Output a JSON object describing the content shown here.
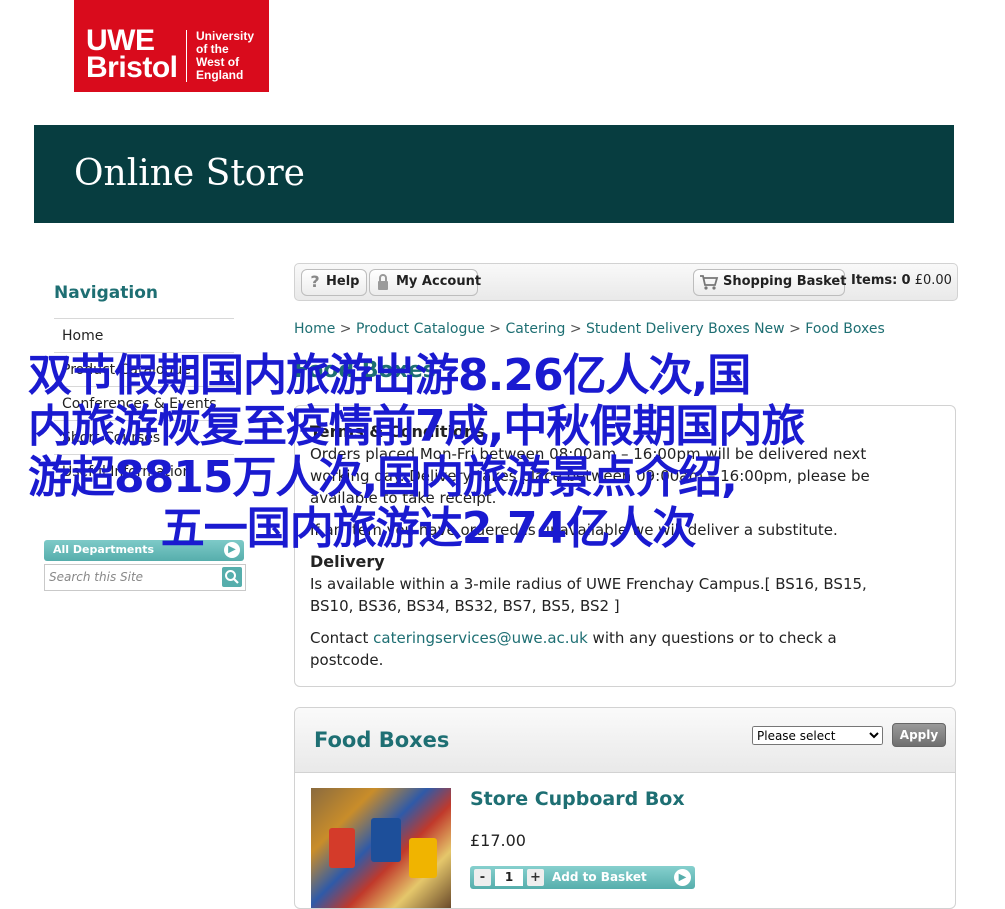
{
  "logo": {
    "line1": "UWE",
    "line2": "Bristol",
    "sub": "University\nof the\nWest of\nEngland"
  },
  "banner": {
    "title": "Online Store"
  },
  "nav": {
    "heading": "Navigation",
    "items": [
      "Home",
      "Product Catalogue",
      "Conferences & Events",
      "Short Courses",
      "Useful Information"
    ]
  },
  "departments": {
    "label": "All Departments",
    "search_placeholder": "Search this Site"
  },
  "toolbar": {
    "help": "Help",
    "account": "My Account",
    "basket": "Shopping Basket",
    "items_label": "Items:",
    "items_count": "0",
    "items_total": "£0.00"
  },
  "breadcrumb": [
    "Home",
    "Product Catalogue",
    "Catering",
    "Student Delivery Boxes New",
    "Food Boxes"
  ],
  "breadcrumb_sep": ">",
  "page_heading": "Food Boxes",
  "terms": {
    "heading": "Terms & Conditions",
    "line1": "Orders placed Mon-Fri between 08:00am – 16:00pm will be delivered next",
    "line2": "working day. Delivery takes place between 09:00am – 16:00pm, please be",
    "line3": "available to take receipt.",
    "line4": "If an item you have ordered is unavailable we will deliver a substitute.",
    "delivery_heading": "Delivery",
    "delivery_line1": "Is available within a 3-mile radius of UWE Frenchay Campus.[ BS16, BS15,",
    "delivery_line2": "BS10, BS36, BS34, BS32, BS7, BS5, BS2 ]",
    "contact_prefix": "Contact ",
    "contact_email": "cateringservices@uwe.ac.uk",
    "contact_suffix": " with any questions or to check a",
    "contact_line2": "postcode."
  },
  "products": {
    "title": "Food Boxes",
    "sort_selected": "Please select",
    "apply": "Apply",
    "item": {
      "name": "Store Cupboard Box",
      "price": "£17.00",
      "qty": "1",
      "add": "Add to Basket"
    }
  },
  "overlay": {
    "line1": "双节假期国内旅游出游8.26亿人次,国",
    "line2": "内旅游恢复至疫情前7成,中秋假期国内旅",
    "line3": "游超8815万人次,国内旅游景点介绍,",
    "line4": "五一国内旅游达2.74亿人次"
  },
  "colors": {
    "brand_red": "#d90b1c",
    "banner": "#073d40",
    "accent_teal": "#1e6f73",
    "overlay_blue": "#1a1ad0"
  }
}
